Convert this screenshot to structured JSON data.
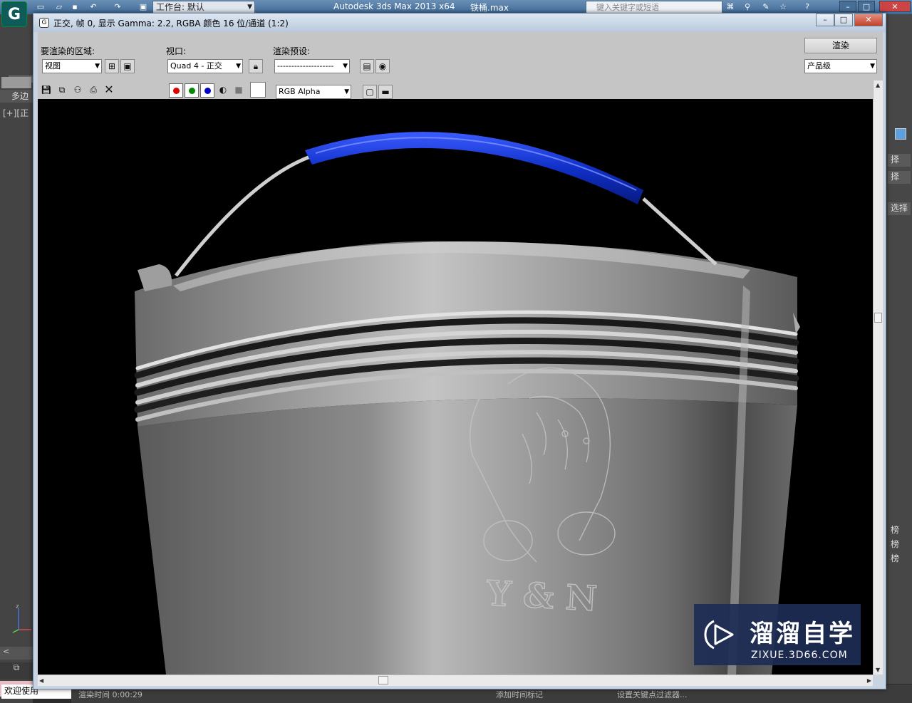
{
  "app": {
    "workspace": "工作台: 默认",
    "title": "Autodesk 3ds Max  2013 x64",
    "file": "铁桶.max",
    "help_search_placeholder": "键入关键字或短语",
    "left_tab": "多边",
    "viewport_label": "[+][正",
    "status_welcome": "欢迎使用",
    "render_time": "渲染时间  0:00:29",
    "add_time_tag": "添加时间标记",
    "keys_label": "设置关键点过滤器..."
  },
  "right_panel": {
    "items": [
      "择",
      "择",
      "选择"
    ],
    "bottom_items": [
      "榜",
      "榜",
      "榜"
    ]
  },
  "render_window": {
    "title": "正交, 帧 0, 显示 Gamma: 2.2, RGBA 颜色 16 位/通道 (1:2)",
    "area_label": "要渲染的区域:",
    "area_value": "视图",
    "viewport_label": "视口:",
    "viewport_value": "Quad 4 - 正交",
    "preset_label": "渲染预设:",
    "preset_value": "--------------------",
    "render_button": "渲染",
    "quality_value": "产品级",
    "channel_value": "RGB Alpha",
    "channel_colors": {
      "red": "#e00000",
      "green": "#008800",
      "blue": "#0000cc"
    }
  },
  "render_image": {
    "emboss_text": "Y & N",
    "handle_grip_color": "#1130c8"
  },
  "watermark": {
    "cn": "溜溜自学",
    "url": "ZIXUE.3D66.COM"
  }
}
